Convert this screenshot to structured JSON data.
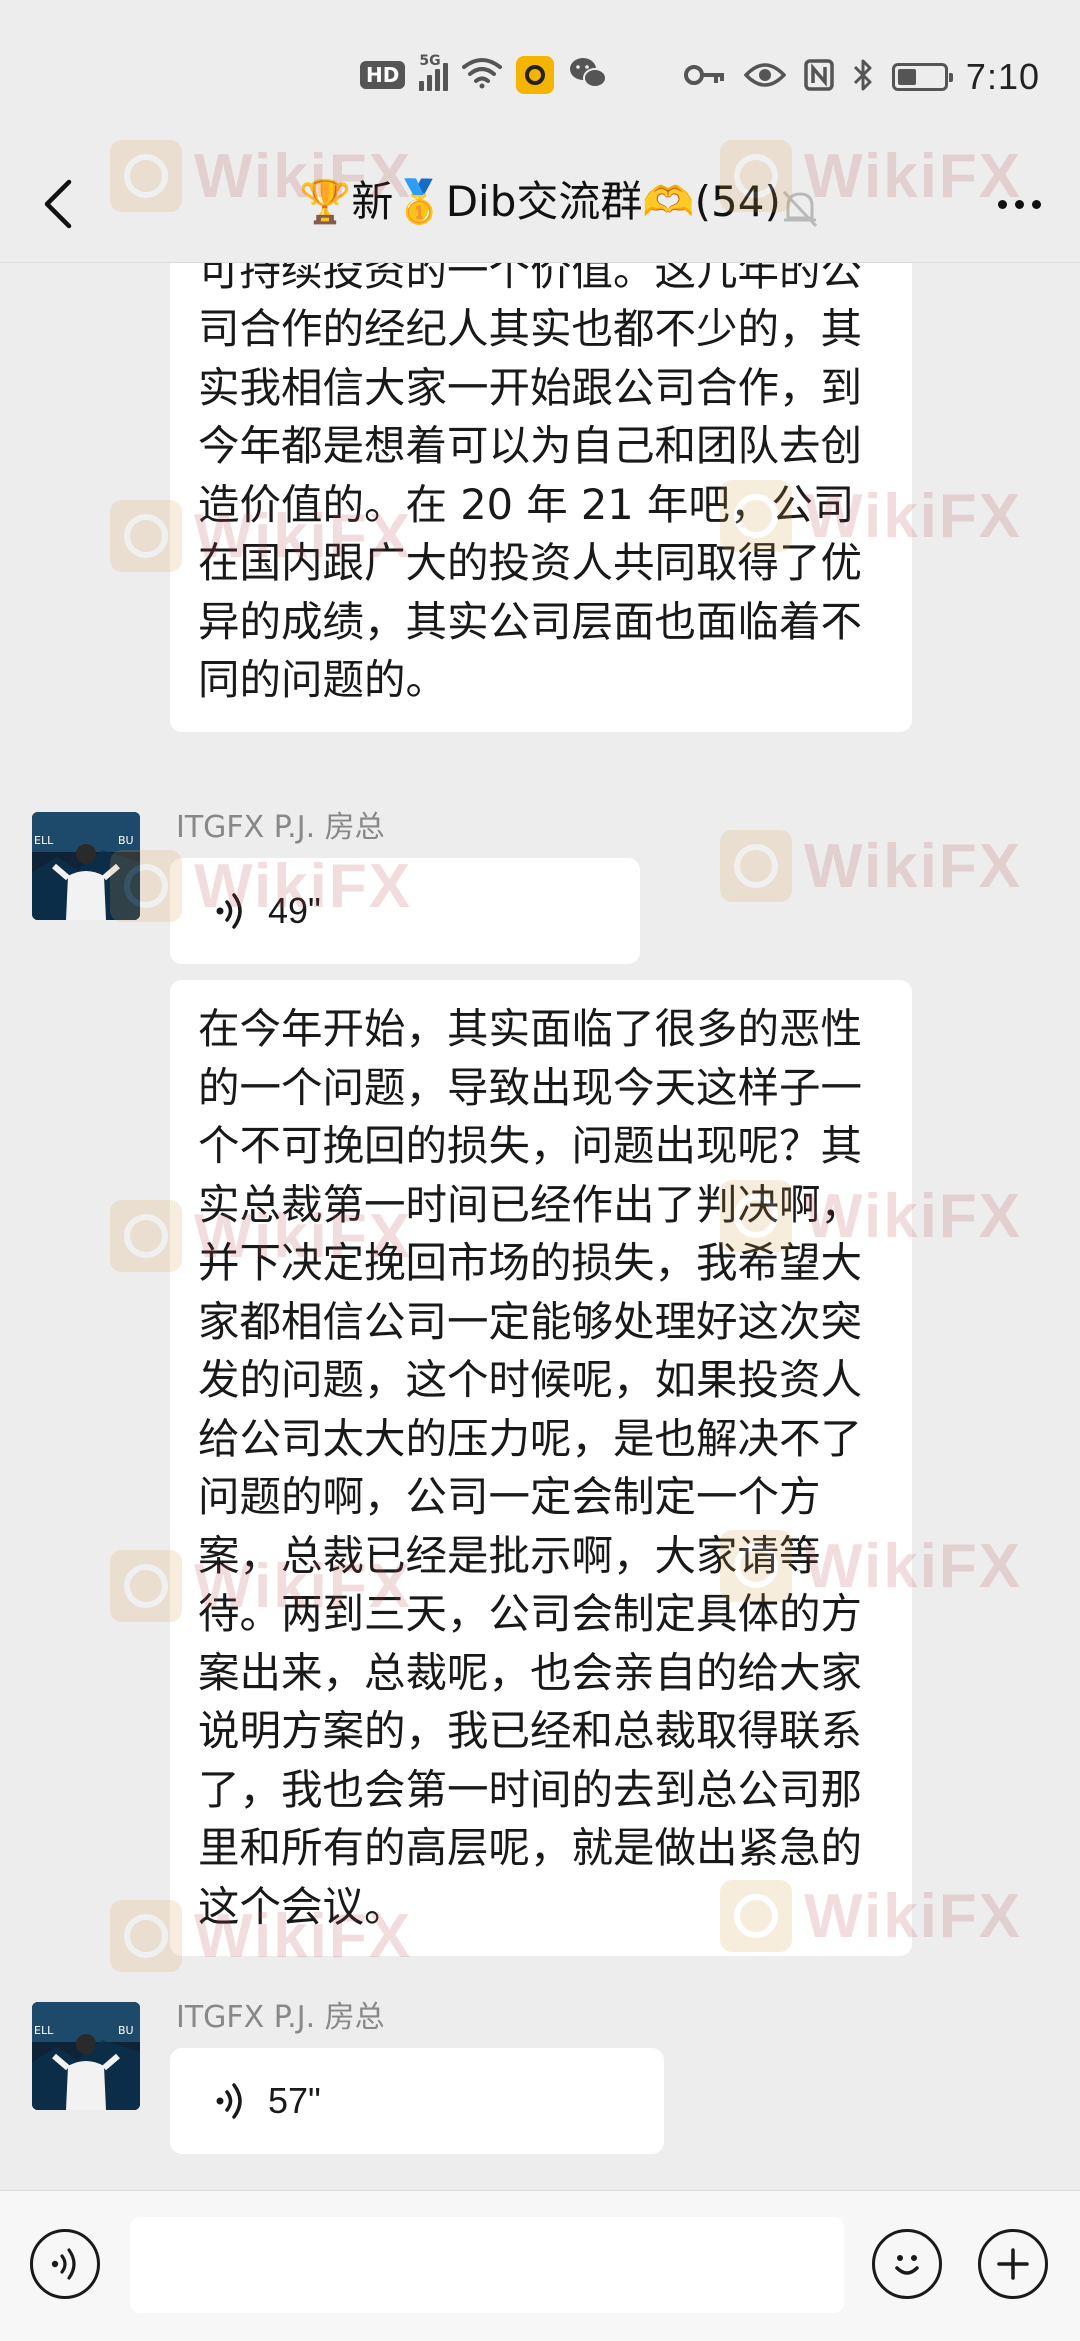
{
  "status_bar": {
    "hd": "HD",
    "network_gen": "5G",
    "time": "7:10"
  },
  "header": {
    "title": "🏆新🥇Dib交流群🫶(54)"
  },
  "messages": [
    {
      "type": "text",
      "text": "合作的理念。为经纪人、投资人创造可持续投资的一个价值。这几年的公司合作的经纪人其实也都不少的，其实我相信大家一开始跟公司合作，到今年都是想着可以为自己和团队去创造价值的。在 20 年 21 年吧，公司在国内跟广大的投资人共同取得了优异的成绩，其实公司层面也面临着不同的问题的。"
    },
    {
      "type": "voice",
      "sender": "ITGFX P.J. 房总",
      "duration": "49\""
    },
    {
      "type": "text",
      "text": "在今年开始，其实面临了很多的恶性的一个问题，导致出现今天这样子一个不可挽回的损失，问题出现呢？其实总裁第一时间已经作出了判决啊，并下决定挽回市场的损失，我希望大家都相信公司一定能够处理好这次突发的问题，这个时候呢，如果投资人给公司太大的压力呢，是也解决不了问题的啊，公司一定会制定一个方案，总裁已经是批示啊，大家请等待。两到三天，公司会制定具体的方案出来，总裁呢，也会亲自的给大家说明方案的，我已经和总裁取得联系了，我也会第一时间的去到总公司那里和所有的高层呢，就是做出紧急的这个会议。"
    },
    {
      "type": "voice",
      "sender": "ITGFX P.J. 房总",
      "duration": "57\""
    }
  ],
  "watermark": {
    "text": "WikiFX"
  },
  "input": {
    "value": ""
  },
  "colors": {
    "background": "#ededed",
    "bubble": "#ffffff",
    "sender_name": "#888888"
  }
}
